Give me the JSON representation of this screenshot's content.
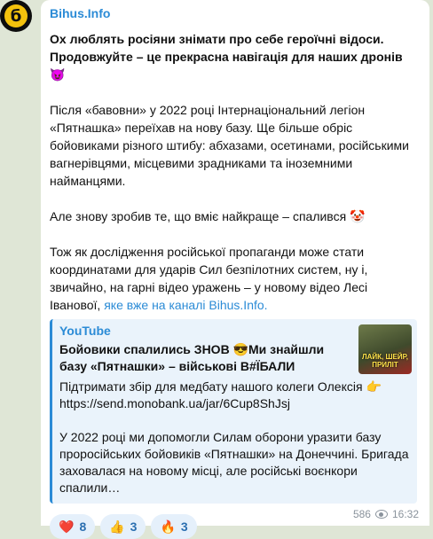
{
  "channel": {
    "name": "Bihus.Info",
    "avatar_letter": "б"
  },
  "message": {
    "headline": "Ох люблять росіяни знімати про себе героїчні відоси. Продовжуйте – це прекрасна навігація для наших дронів 😈",
    "para1": "Після «бавовни» у 2022 році Інтернаціональний легіон «Пятнашка» переїхав на нову базу. Ще більше обріс бойовиками різного штибу: абхазами, осетинами, російськими вагнерівцями, місцевими зрадниками та іноземними найманцями.",
    "para2": "Але знову зробив те, що вміє найкраще – спалився 🤡",
    "para3_text": "Тож як дослідження російської пропаганди може стати координатами для ударів Сил безпілотних систем, ну і, звичайно, на гарні відео уражень – у новому відео Лесі Іванової, ",
    "para3_link": "яке вже на каналі Bihus.Info."
  },
  "preview": {
    "source": "YouTube",
    "title": "Бойовики спалились ЗНОВ 😎Ми знайшли базу «Пятнашки» – військові В#ЇБАЛИ",
    "desc1": "Підтримати збір для медбату нашого колеги Олексія 👉 https://send.monobank.ua/jar/6Cup8ShJsj",
    "desc2": "У 2022 році ми допомогли Силам оборони уразити базу проросійських бойовиків «Пятнашки» на Донеччині. Бригада заховалася на новому місці, але російські воєнкори спалили…",
    "thumb_caption": "ЛАЙК, ШЕЙР, ПРИЛІТ"
  },
  "reactions": [
    {
      "emoji": "❤️",
      "count": "8"
    },
    {
      "emoji": "👍",
      "count": "3"
    },
    {
      "emoji": "🔥",
      "count": "3"
    }
  ],
  "meta": {
    "views": "586",
    "time": "16:32"
  }
}
